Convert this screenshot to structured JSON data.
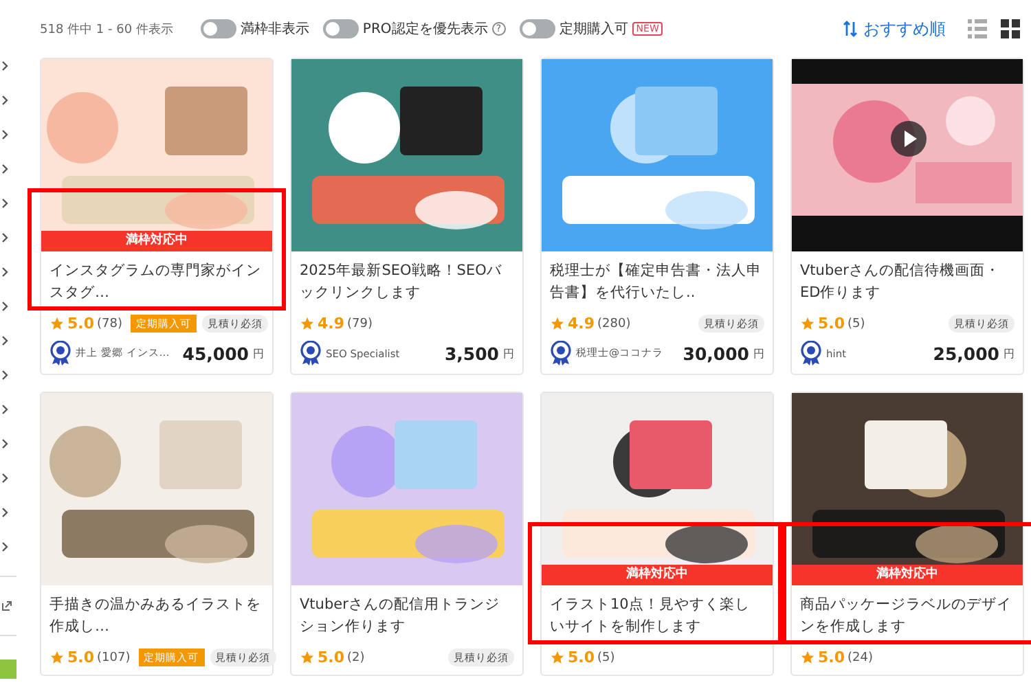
{
  "result_count": "518 件中 1 - 60 件表示",
  "filters": [
    {
      "label": "満枠非表示",
      "on": false
    },
    {
      "label": "PRO認定を優先表示",
      "on": false,
      "help": "?"
    },
    {
      "label": "定期購入可",
      "on": false,
      "badge": "NEW"
    }
  ],
  "sort": {
    "label": "おすすめ順"
  },
  "view_modes": [
    {
      "kind": "list",
      "selected": false
    },
    {
      "kind": "grid",
      "selected": true
    }
  ],
  "cards": [
    {
      "kind": "picture",
      "ribbon": "満枠対応中",
      "highlighted": true,
      "title": "インスタグラムの専門家がインスタグ…",
      "tags": [
        {
          "kind": "subscription",
          "label": "定期購入可"
        },
        {
          "kind": "quote",
          "label": "見積り必須"
        }
      ],
      "rating": "5.0",
      "reviews": "(78)",
      "seller": "井上 愛郷 インス…",
      "price": "45,000",
      "currency": "円"
    },
    {
      "kind": "picture",
      "highlighted": false,
      "title": "2025年最新SEO戦略！SEOバックリンクします",
      "rating": "4.9",
      "reviews": "(79)",
      "seller": "SEO Specialist",
      "price": "3,500",
      "currency": "円"
    },
    {
      "kind": "picture",
      "highlighted": false,
      "title": "税理士が【確定申告書・法人申告書】を代行いたし..",
      "tags": [
        {
          "kind": "quote",
          "label": "見積り必須"
        }
      ],
      "rating": "4.9",
      "reviews": "(280)",
      "seller": "税理士@ココナラ",
      "price": "30,000",
      "currency": "円"
    },
    {
      "kind": "video",
      "highlighted": false,
      "title": "Vtuberさんの配信待機画面・ED作ります",
      "tags": [
        {
          "kind": "quote",
          "label": "見積り必須"
        }
      ],
      "rating": "5.0",
      "reviews": "(5)",
      "seller": "hint",
      "price": "25,000",
      "currency": "円"
    },
    {
      "kind": "picture",
      "highlighted": false,
      "title": "手描きの温かみあるイラストを作成し…",
      "tags": [
        {
          "kind": "subscription",
          "label": "定期購入可"
        },
        {
          "kind": "quote",
          "label": "見積り必須"
        }
      ],
      "rating": "5.0",
      "reviews": "(107)"
    },
    {
      "kind": "picture",
      "highlighted": false,
      "title": "Vtuberさんの配信用トランジション作ります",
      "tags": [
        {
          "kind": "quote",
          "label": "見積り必須"
        }
      ],
      "rating": "5.0",
      "reviews": "(2)"
    },
    {
      "kind": "picture",
      "ribbon": "満枠対応中",
      "highlighted": true,
      "title": "イラスト10点！見やすく楽しいサイトを制作します",
      "rating": "5.0",
      "reviews": "(5)"
    },
    {
      "kind": "picture",
      "ribbon": "満枠対応中",
      "highlighted": true,
      "title": "商品パッケージラベルのデザインを作成します",
      "rating": "5.0",
      "reviews": "(24)"
    }
  ]
}
